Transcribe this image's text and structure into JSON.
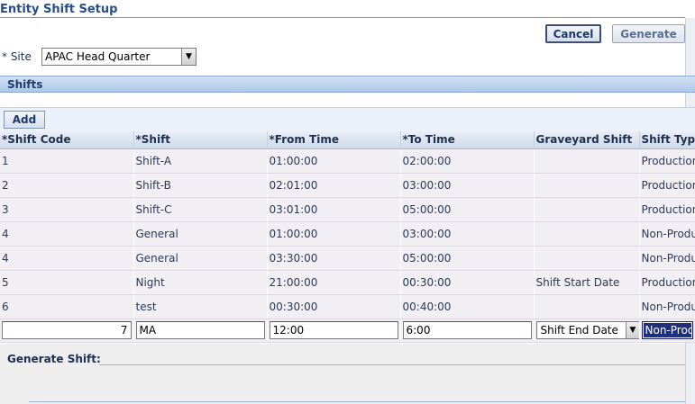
{
  "page": {
    "title": "Entity Shift Setup"
  },
  "actions": {
    "cancel_label": "Cancel",
    "generate_label": "Generate"
  },
  "site": {
    "label": "* Site",
    "value": "APAC Head Quarter"
  },
  "shifts": {
    "header": "Shifts",
    "add_label": "Add",
    "columns": [
      "*Shift Code",
      "*Shift",
      "*From Time",
      "*To Time",
      "Graveyard Shift",
      "Shift Type"
    ],
    "rows": [
      {
        "code": "1",
        "shift": "Shift-A",
        "from": "01:00:00",
        "to": "02:00:00",
        "graveyard": "",
        "type": "Production"
      },
      {
        "code": "2",
        "shift": "Shift-B",
        "from": "02:01:00",
        "to": "03:00:00",
        "graveyard": "",
        "type": "Production"
      },
      {
        "code": "3",
        "shift": "Shift-C",
        "from": "03:01:00",
        "to": "05:00:00",
        "graveyard": "",
        "type": "Production"
      },
      {
        "code": "4",
        "shift": "General",
        "from": "01:00:00",
        "to": "03:00:00",
        "graveyard": "",
        "type": "Non-Production"
      },
      {
        "code": "4",
        "shift": "General",
        "from": "03:30:00",
        "to": "05:00:00",
        "graveyard": "",
        "type": "Non-Production"
      },
      {
        "code": "5",
        "shift": "Night",
        "from": "21:00:00",
        "to": "00:30:00",
        "graveyard": "Shift Start Date",
        "type": "Production"
      },
      {
        "code": "6",
        "shift": "test",
        "from": "00:30:00",
        "to": "00:40:00",
        "graveyard": "",
        "type": "Non-Production"
      }
    ],
    "edit_row": {
      "code": "7",
      "shift": "MA",
      "from": "12:00",
      "to": "6:00",
      "graveyard": "Shift End Date",
      "type": "Non-Production"
    }
  },
  "generate_section": {
    "title": "Generate Shift:"
  },
  "icons": {
    "dropdown": "chevron-down-icon"
  }
}
